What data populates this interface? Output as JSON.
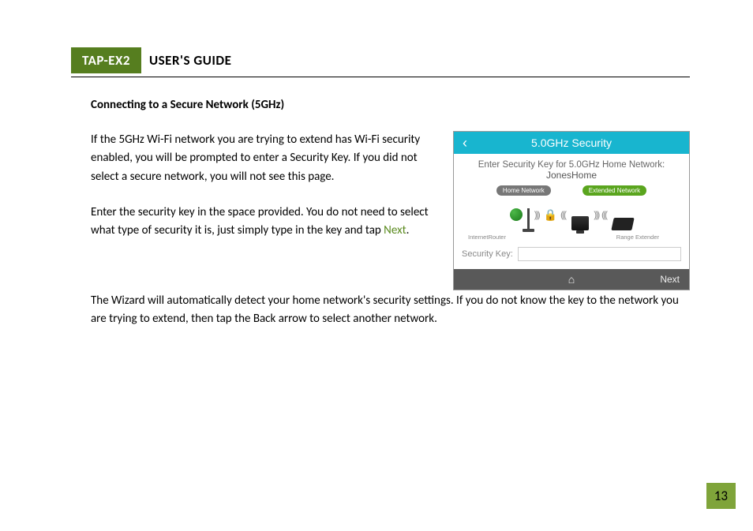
{
  "header": {
    "product": "TAP-EX2",
    "title": "USER'S GUIDE"
  },
  "section": {
    "heading": "Connecting to a Secure Network (5GHz)",
    "para1": "If the 5GHz Wi-Fi network you are trying to extend has Wi-Fi security enabled, you will be prompted to enter a Security Key. If you did not select a secure network, you will not see this page.",
    "para2_a": "Enter the security key in the space provided. You do not need to select what type of security it is, just simply type in the key and tap ",
    "para2_link": "Next",
    "para2_b": ".",
    "para3": "The Wizard will automatically detect your home network's security settings. If you do not know the key to the network you are trying to extend, then tap the Back arrow to select another network."
  },
  "device": {
    "title": "5.0GHz Security",
    "prompt": "Enter Security Key for 5.0GHz Home Network:",
    "network_name": "JonesHome",
    "badge_home": "Home Network",
    "badge_ext": "Extended Network",
    "label_internet": "Internet",
    "label_router": "Router",
    "label_extender": "Range Extender",
    "key_label": "Security Key:",
    "next": "Next"
  },
  "page_number": "13"
}
